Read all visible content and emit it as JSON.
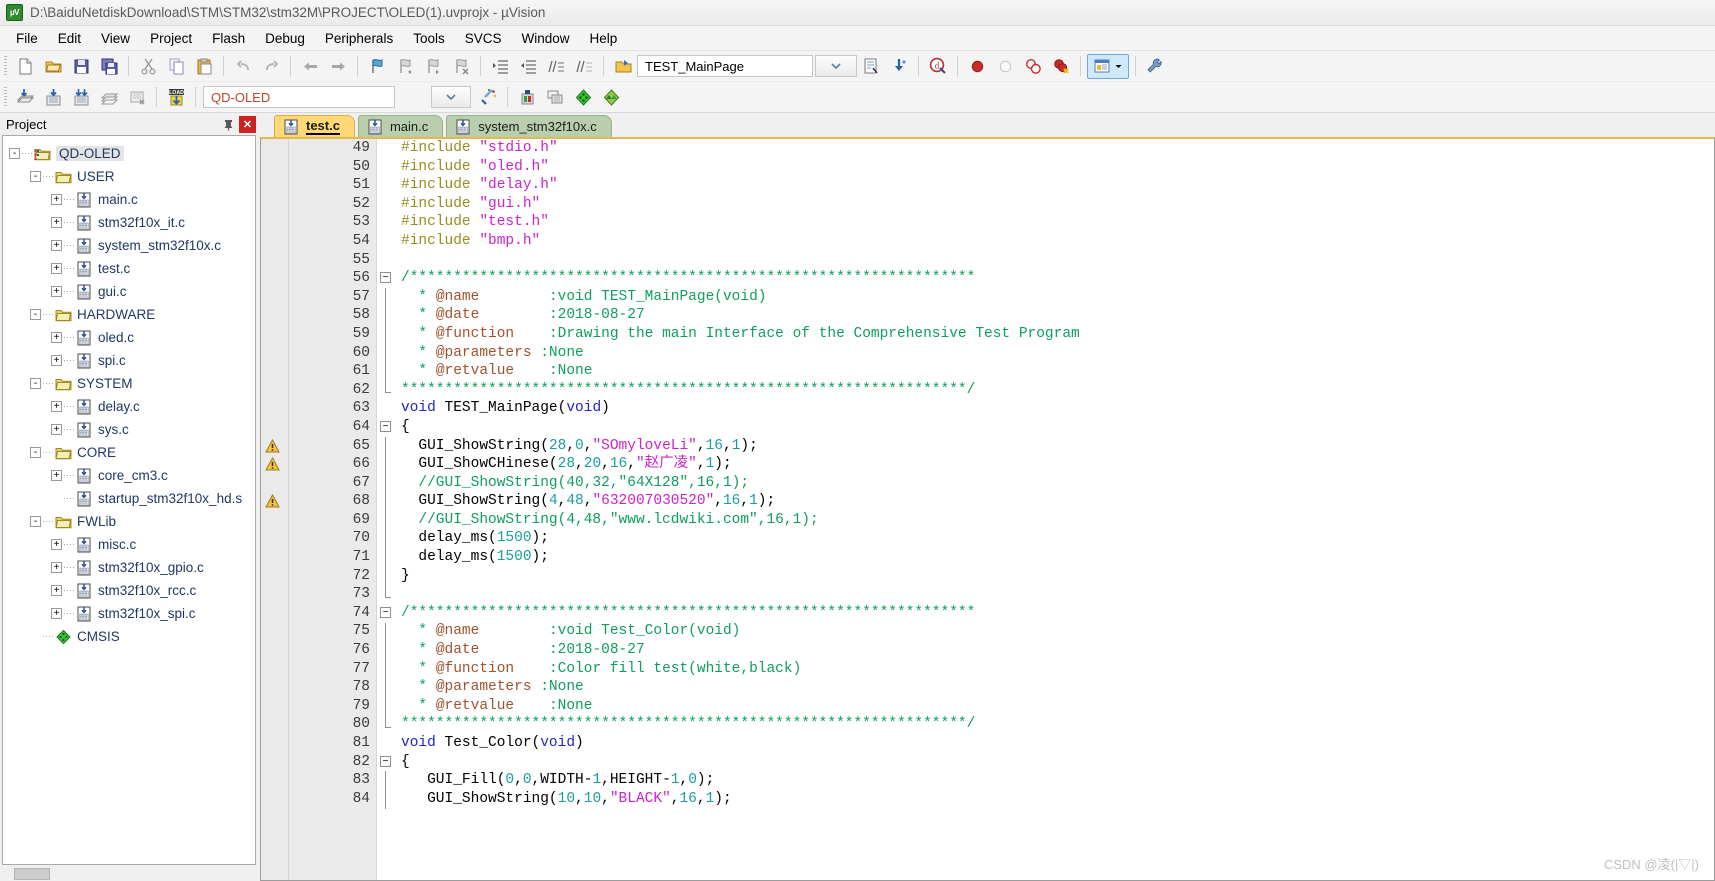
{
  "window": {
    "title": "D:\\BaiduNetdiskDownload\\STM\\STM32\\stm32M\\PROJECT\\OLED(1).uvprojx - µVision",
    "app_icon": "uvision-icon"
  },
  "menu": {
    "items": [
      {
        "label": "File"
      },
      {
        "label": "Edit"
      },
      {
        "label": "View"
      },
      {
        "label": "Project"
      },
      {
        "label": "Flash"
      },
      {
        "label": "Debug"
      },
      {
        "label": "Peripherals"
      },
      {
        "label": "Tools"
      },
      {
        "label": "SVCS"
      },
      {
        "label": "Window"
      },
      {
        "label": "Help"
      }
    ]
  },
  "toolbar_main": {
    "groups": [
      [
        "new-file-icon",
        "open-file-icon",
        "save-icon",
        "save-all-icon"
      ],
      [
        "cut-icon",
        "copy-icon",
        "paste-icon"
      ],
      [
        "undo-icon",
        "redo-icon"
      ],
      [
        "navigate-back-icon",
        "navigate-forward-icon"
      ],
      [
        "bookmark-toggle-icon",
        "bookmark-prev-icon",
        "bookmark-next-icon",
        "bookmark-clear-icon"
      ],
      [
        "indent-increase-icon",
        "indent-decrease-icon",
        "comment-lines-icon",
        "uncomment-lines-icon"
      ]
    ],
    "function_nav": {
      "icon": "function-browse-icon",
      "value": "TEST_MainPage",
      "dropdown_icon": "chevron-down-icon"
    },
    "after_combo": [
      "find-in-files-icon",
      "insert-snippet-icon"
    ],
    "debug": {
      "start_debug_icon": "start-debug-session-icon",
      "breakpoint_icon": "insert-breakpoint-icon",
      "breakpoint_disable_icon": "disable-breakpoint-icon",
      "breakpoint_all_icon": "disable-all-breakpoints-icon",
      "breakpoint_kill_icon": "kill-all-breakpoints-icon"
    },
    "window_toggle": {
      "icon": "project-window-icon",
      "dropdown_icon": "chevron-down-small-icon",
      "active": true
    },
    "configure_icon": "configure-toolbars-icon"
  },
  "toolbar_build": {
    "left_icons": [
      "translate-file-icon",
      "build-target-icon",
      "rebuild-all-icon",
      "batch-build-icon",
      "stop-build-icon"
    ],
    "load_icon": "download-to-flash-icon",
    "target_select": {
      "value": "QD-OLED",
      "dropdown_icon": "chevron-down-icon"
    },
    "right_icons": [
      "target-options-icon",
      "manage-project-items-icon",
      "multi-project-icon",
      "pack-installer-icon"
    ]
  },
  "sidebar": {
    "title": "Project",
    "pin_icon": "pin-icon",
    "close_icon": "close-icon",
    "tree": [
      {
        "depth": 0,
        "expander": "-",
        "icon": "target-folder-icon",
        "label": "QD-OLED",
        "selected": true
      },
      {
        "depth": 1,
        "expander": "-",
        "icon": "group-folder-icon",
        "label": "USER"
      },
      {
        "depth": 2,
        "expander": "+",
        "icon": "c-file-icon",
        "label": "main.c"
      },
      {
        "depth": 2,
        "expander": "+",
        "icon": "c-file-icon",
        "label": "stm32f10x_it.c"
      },
      {
        "depth": 2,
        "expander": "+",
        "icon": "c-file-icon",
        "label": "system_stm32f10x.c"
      },
      {
        "depth": 2,
        "expander": "+",
        "icon": "c-file-icon",
        "label": "test.c"
      },
      {
        "depth": 2,
        "expander": "+",
        "icon": "c-file-icon",
        "label": "gui.c"
      },
      {
        "depth": 1,
        "expander": "-",
        "icon": "group-folder-icon",
        "label": "HARDWARE"
      },
      {
        "depth": 2,
        "expander": "+",
        "icon": "c-file-icon",
        "label": "oled.c"
      },
      {
        "depth": 2,
        "expander": "+",
        "icon": "c-file-icon",
        "label": "spi.c"
      },
      {
        "depth": 1,
        "expander": "-",
        "icon": "group-folder-icon",
        "label": "SYSTEM"
      },
      {
        "depth": 2,
        "expander": "+",
        "icon": "c-file-icon",
        "label": "delay.c"
      },
      {
        "depth": 2,
        "expander": "+",
        "icon": "c-file-icon",
        "label": "sys.c"
      },
      {
        "depth": 1,
        "expander": "-",
        "icon": "group-folder-icon",
        "label": "CORE"
      },
      {
        "depth": 2,
        "expander": "+",
        "icon": "c-file-icon",
        "label": "core_cm3.c"
      },
      {
        "depth": 2,
        "expander": "",
        "icon": "asm-file-icon",
        "label": "startup_stm32f10x_hd.s"
      },
      {
        "depth": 1,
        "expander": "-",
        "icon": "group-folder-icon",
        "label": "FWLib"
      },
      {
        "depth": 2,
        "expander": "+",
        "icon": "c-file-icon",
        "label": "misc.c"
      },
      {
        "depth": 2,
        "expander": "+",
        "icon": "c-file-icon",
        "label": "stm32f10x_gpio.c"
      },
      {
        "depth": 2,
        "expander": "+",
        "icon": "c-file-icon",
        "label": "stm32f10x_rcc.c"
      },
      {
        "depth": 2,
        "expander": "+",
        "icon": "c-file-icon",
        "label": "stm32f10x_spi.c"
      },
      {
        "depth": 1,
        "expander": "",
        "icon": "cmsis-icon",
        "label": "CMSIS"
      }
    ]
  },
  "tabs": [
    {
      "label": "test.c",
      "icon": "c-file-icon",
      "active": true
    },
    {
      "label": "main.c",
      "icon": "c-file-icon",
      "active": false
    },
    {
      "label": "system_stm32f10x.c",
      "icon": "c-file-icon",
      "active": false
    }
  ],
  "editor": {
    "first_line": 49,
    "lines": [
      {
        "n": 49,
        "fold": "",
        "warn": false,
        "tokens": [
          {
            "t": "#include ",
            "c": "s-pre"
          },
          {
            "t": "\"stdio.h\"",
            "c": "s-str"
          }
        ]
      },
      {
        "n": 50,
        "fold": "",
        "warn": false,
        "tokens": [
          {
            "t": "#include ",
            "c": "s-pre"
          },
          {
            "t": "\"oled.h\"",
            "c": "s-str"
          }
        ]
      },
      {
        "n": 51,
        "fold": "",
        "warn": false,
        "tokens": [
          {
            "t": "#include ",
            "c": "s-pre"
          },
          {
            "t": "\"delay.h\"",
            "c": "s-str"
          }
        ]
      },
      {
        "n": 52,
        "fold": "",
        "warn": false,
        "tokens": [
          {
            "t": "#include ",
            "c": "s-pre"
          },
          {
            "t": "\"gui.h\"",
            "c": "s-str"
          }
        ]
      },
      {
        "n": 53,
        "fold": "",
        "warn": false,
        "tokens": [
          {
            "t": "#include ",
            "c": "s-pre"
          },
          {
            "t": "\"test.h\"",
            "c": "s-str"
          }
        ]
      },
      {
        "n": 54,
        "fold": "",
        "warn": false,
        "tokens": [
          {
            "t": "#include ",
            "c": "s-pre"
          },
          {
            "t": "\"bmp.h\"",
            "c": "s-str"
          }
        ]
      },
      {
        "n": 55,
        "fold": "",
        "warn": false,
        "tokens": []
      },
      {
        "n": 56,
        "fold": "start",
        "warn": false,
        "tokens": [
          {
            "t": "/*****************************************************************",
            "c": "s-cmt"
          }
        ]
      },
      {
        "n": 57,
        "fold": "mid",
        "warn": false,
        "tokens": [
          {
            "t": "  * ",
            "c": "s-cmt"
          },
          {
            "t": "@name",
            "c": "s-tag"
          },
          {
            "t": "        :void TEST_MainPage(void)",
            "c": "s-cmt"
          }
        ]
      },
      {
        "n": 58,
        "fold": "mid",
        "warn": false,
        "tokens": [
          {
            "t": "  * ",
            "c": "s-cmt"
          },
          {
            "t": "@date",
            "c": "s-tag"
          },
          {
            "t": "        :2018-08-27",
            "c": "s-cmt"
          }
        ]
      },
      {
        "n": 59,
        "fold": "mid",
        "warn": false,
        "tokens": [
          {
            "t": "  * ",
            "c": "s-cmt"
          },
          {
            "t": "@function",
            "c": "s-tag"
          },
          {
            "t": "    :Drawing the main Interface of the Comprehensive Test Program",
            "c": "s-cmt"
          }
        ]
      },
      {
        "n": 60,
        "fold": "mid",
        "warn": false,
        "tokens": [
          {
            "t": "  * ",
            "c": "s-cmt"
          },
          {
            "t": "@parameters",
            "c": "s-tag"
          },
          {
            "t": " :None",
            "c": "s-cmt"
          }
        ]
      },
      {
        "n": 61,
        "fold": "mid",
        "warn": false,
        "tokens": [
          {
            "t": "  * ",
            "c": "s-cmt"
          },
          {
            "t": "@retvalue",
            "c": "s-tag"
          },
          {
            "t": "    :None",
            "c": "s-cmt"
          }
        ]
      },
      {
        "n": 62,
        "fold": "end",
        "warn": false,
        "tokens": [
          {
            "t": "*****************************************************************/",
            "c": "s-cmt"
          }
        ]
      },
      {
        "n": 63,
        "fold": "",
        "warn": false,
        "tokens": [
          {
            "t": "void",
            "c": "s-kw"
          },
          {
            "t": " TEST_MainPage(",
            "c": "s-plain"
          },
          {
            "t": "void",
            "c": "s-kw"
          },
          {
            "t": ")",
            "c": "s-plain"
          }
        ]
      },
      {
        "n": 64,
        "fold": "start",
        "warn": false,
        "tokens": [
          {
            "t": "{",
            "c": "s-plain"
          }
        ]
      },
      {
        "n": 65,
        "fold": "mid",
        "warn": true,
        "tokens": [
          {
            "t": "  GUI_ShowString(",
            "c": "s-plain"
          },
          {
            "t": "28",
            "c": "s-num"
          },
          {
            "t": ",",
            "c": "s-plain"
          },
          {
            "t": "0",
            "c": "s-num"
          },
          {
            "t": ",",
            "c": "s-plain"
          },
          {
            "t": "\"SOmyloveLi\"",
            "c": "s-str"
          },
          {
            "t": ",",
            "c": "s-plain"
          },
          {
            "t": "16",
            "c": "s-num"
          },
          {
            "t": ",",
            "c": "s-plain"
          },
          {
            "t": "1",
            "c": "s-num"
          },
          {
            "t": ");",
            "c": "s-plain"
          }
        ]
      },
      {
        "n": 66,
        "fold": "mid",
        "warn": true,
        "tokens": [
          {
            "t": "  GUI_ShowCHinese(",
            "c": "s-plain"
          },
          {
            "t": "28",
            "c": "s-num"
          },
          {
            "t": ",",
            "c": "s-plain"
          },
          {
            "t": "20",
            "c": "s-num"
          },
          {
            "t": ",",
            "c": "s-plain"
          },
          {
            "t": "16",
            "c": "s-num"
          },
          {
            "t": ",",
            "c": "s-plain"
          },
          {
            "t": "\"赵广凌\"",
            "c": "s-str"
          },
          {
            "t": ",",
            "c": "s-plain"
          },
          {
            "t": "1",
            "c": "s-num"
          },
          {
            "t": ");",
            "c": "s-plain"
          }
        ]
      },
      {
        "n": 67,
        "fold": "mid",
        "warn": false,
        "tokens": [
          {
            "t": "  //GUI_ShowString(40,32,\"64X128\",16,1);",
            "c": "s-cmt"
          }
        ]
      },
      {
        "n": 68,
        "fold": "mid",
        "warn": true,
        "tokens": [
          {
            "t": "  GUI_ShowString(",
            "c": "s-plain"
          },
          {
            "t": "4",
            "c": "s-num"
          },
          {
            "t": ",",
            "c": "s-plain"
          },
          {
            "t": "48",
            "c": "s-num"
          },
          {
            "t": ",",
            "c": "s-plain"
          },
          {
            "t": "\"632007030520\"",
            "c": "s-str"
          },
          {
            "t": ",",
            "c": "s-plain"
          },
          {
            "t": "16",
            "c": "s-num"
          },
          {
            "t": ",",
            "c": "s-plain"
          },
          {
            "t": "1",
            "c": "s-num"
          },
          {
            "t": ");",
            "c": "s-plain"
          }
        ]
      },
      {
        "n": 69,
        "fold": "mid",
        "warn": false,
        "tokens": [
          {
            "t": "  //GUI_ShowString(4,48,\"www.lcdwiki.com\",16,1);",
            "c": "s-cmt"
          }
        ]
      },
      {
        "n": 70,
        "fold": "mid",
        "warn": false,
        "tokens": [
          {
            "t": "  delay_ms(",
            "c": "s-plain"
          },
          {
            "t": "1500",
            "c": "s-num"
          },
          {
            "t": ");",
            "c": "s-plain"
          }
        ]
      },
      {
        "n": 71,
        "fold": "mid",
        "warn": false,
        "tokens": [
          {
            "t": "  delay_ms(",
            "c": "s-plain"
          },
          {
            "t": "1500",
            "c": "s-num"
          },
          {
            "t": ");",
            "c": "s-plain"
          }
        ]
      },
      {
        "n": 72,
        "fold": "mid",
        "warn": false,
        "tokens": [
          {
            "t": "}",
            "c": "s-plain"
          }
        ]
      },
      {
        "n": 73,
        "fold": "end",
        "warn": false,
        "tokens": []
      },
      {
        "n": 74,
        "fold": "start",
        "warn": false,
        "tokens": [
          {
            "t": "/*****************************************************************",
            "c": "s-cmt"
          }
        ]
      },
      {
        "n": 75,
        "fold": "mid",
        "warn": false,
        "tokens": [
          {
            "t": "  * ",
            "c": "s-cmt"
          },
          {
            "t": "@name",
            "c": "s-tag"
          },
          {
            "t": "        :void Test_Color(void)",
            "c": "s-cmt"
          }
        ]
      },
      {
        "n": 76,
        "fold": "mid",
        "warn": false,
        "tokens": [
          {
            "t": "  * ",
            "c": "s-cmt"
          },
          {
            "t": "@date",
            "c": "s-tag"
          },
          {
            "t": "        :2018-08-27",
            "c": "s-cmt"
          }
        ]
      },
      {
        "n": 77,
        "fold": "mid",
        "warn": false,
        "tokens": [
          {
            "t": "  * ",
            "c": "s-cmt"
          },
          {
            "t": "@function",
            "c": "s-tag"
          },
          {
            "t": "    :Color fill test(white,black)",
            "c": "s-cmt"
          }
        ]
      },
      {
        "n": 78,
        "fold": "mid",
        "warn": false,
        "tokens": [
          {
            "t": "  * ",
            "c": "s-cmt"
          },
          {
            "t": "@parameters",
            "c": "s-tag"
          },
          {
            "t": " :None",
            "c": "s-cmt"
          }
        ]
      },
      {
        "n": 79,
        "fold": "mid",
        "warn": false,
        "tokens": [
          {
            "t": "  * ",
            "c": "s-cmt"
          },
          {
            "t": "@retvalue",
            "c": "s-tag"
          },
          {
            "t": "    :None",
            "c": "s-cmt"
          }
        ]
      },
      {
        "n": 80,
        "fold": "end",
        "warn": false,
        "tokens": [
          {
            "t": "*****************************************************************/",
            "c": "s-cmt"
          }
        ]
      },
      {
        "n": 81,
        "fold": "",
        "warn": false,
        "tokens": [
          {
            "t": "void",
            "c": "s-kw"
          },
          {
            "t": " Test_Color(",
            "c": "s-plain"
          },
          {
            "t": "void",
            "c": "s-kw"
          },
          {
            "t": ")",
            "c": "s-plain"
          }
        ]
      },
      {
        "n": 82,
        "fold": "start",
        "warn": false,
        "tokens": [
          {
            "t": "{",
            "c": "s-plain"
          }
        ]
      },
      {
        "n": 83,
        "fold": "mid",
        "warn": false,
        "tokens": [
          {
            "t": "   GUI_Fill(",
            "c": "s-plain"
          },
          {
            "t": "0",
            "c": "s-num"
          },
          {
            "t": ",",
            "c": "s-plain"
          },
          {
            "t": "0",
            "c": "s-num"
          },
          {
            "t": ",WIDTH-",
            "c": "s-plain"
          },
          {
            "t": "1",
            "c": "s-num"
          },
          {
            "t": ",HEIGHT-",
            "c": "s-plain"
          },
          {
            "t": "1",
            "c": "s-num"
          },
          {
            "t": ",",
            "c": "s-plain"
          },
          {
            "t": "0",
            "c": "s-num"
          },
          {
            "t": ");",
            "c": "s-plain"
          }
        ]
      },
      {
        "n": 84,
        "fold": "mid",
        "warn": false,
        "tokens": [
          {
            "t": "   GUI_ShowString(",
            "c": "s-plain"
          },
          {
            "t": "10",
            "c": "s-num"
          },
          {
            "t": ",",
            "c": "s-plain"
          },
          {
            "t": "10",
            "c": "s-num"
          },
          {
            "t": ",",
            "c": "s-plain"
          },
          {
            "t": "\"BLACK\"",
            "c": "s-str"
          },
          {
            "t": ",",
            "c": "s-plain"
          },
          {
            "t": "16",
            "c": "s-num"
          },
          {
            "t": ",",
            "c": "s-plain"
          },
          {
            "t": "1",
            "c": "s-num"
          },
          {
            "t": ");",
            "c": "s-plain"
          }
        ]
      }
    ]
  },
  "watermark": {
    "text": "CSDN @凌(|▽|)"
  },
  "colors": {
    "tab_active": "#ffd978",
    "tab_inactive": "#b8ceac",
    "comment": "#0f9e5e",
    "string": "#cc22cc",
    "keyword": "#2222cc",
    "number": "#1a9ea0",
    "preprocessor": "#9b8b1e",
    "doc_tag": "#a0522d",
    "tree_label": "#1f3864",
    "target_value": "#b8482a"
  }
}
